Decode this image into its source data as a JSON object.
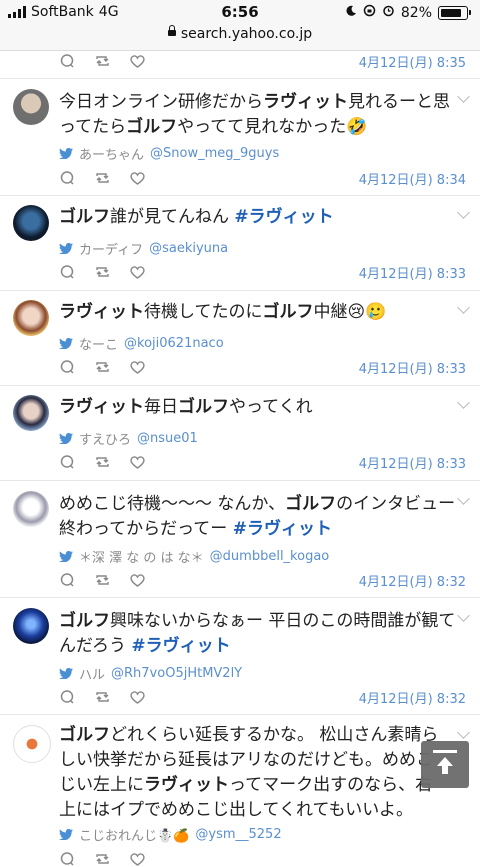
{
  "status_bar": {
    "carrier": "SoftBank",
    "network": "4G",
    "time": "6:56",
    "battery": "82%"
  },
  "browser": {
    "url": "search.yahoo.co.jp"
  },
  "colors": {
    "link_blue": "#5a8fd0",
    "hashtag_blue": "#1f5fb8",
    "divider": "#e6e6e6"
  },
  "top_row": {
    "date": "4月12日(月) 8:35"
  },
  "tweets": [
    {
      "segments": [
        {
          "t": "今日オンライン研修だから",
          "b": false
        },
        {
          "t": "ラヴィット",
          "b": true
        },
        {
          "t": "見れるーと思ってたら",
          "b": false
        },
        {
          "t": "ゴルフ",
          "b": true
        },
        {
          "t": "やってて見れなかった🤣",
          "b": false
        }
      ],
      "name": "あーちゃん",
      "handle": "@Snow_meg_9guys",
      "date": "4月12日(月) 8:34"
    },
    {
      "segments": [
        {
          "t": "ゴルフ",
          "b": true
        },
        {
          "t": "誰が見てんねん ",
          "b": false
        },
        {
          "t": "#ラヴィット",
          "tag": true
        }
      ],
      "name": "カーディフ",
      "handle": "@saekiyuna",
      "date": "4月12日(月) 8:33"
    },
    {
      "segments": [
        {
          "t": "ラヴィット",
          "b": true
        },
        {
          "t": "待機してたのに",
          "b": false
        },
        {
          "t": "ゴルフ",
          "b": true
        },
        {
          "t": "中継😢🥲",
          "b": false
        }
      ],
      "name": "なーこ",
      "handle": "@koji0621naco",
      "date": "4月12日(月) 8:33"
    },
    {
      "segments": [
        {
          "t": "ラヴィット",
          "b": true
        },
        {
          "t": "毎日",
          "b": false
        },
        {
          "t": "ゴルフ",
          "b": true
        },
        {
          "t": "やってくれ",
          "b": false
        }
      ],
      "name": "すえひろ",
      "handle": "@nsue01",
      "date": "4月12日(月) 8:33"
    },
    {
      "segments": [
        {
          "t": "めめこじ待機〜〜〜 なんか、",
          "b": false
        },
        {
          "t": "ゴルフ",
          "b": true
        },
        {
          "t": "のインタビュー終わってからだってー ",
          "b": false
        },
        {
          "t": "#ラヴィット",
          "tag": true
        }
      ],
      "name": "＊深 澤 な の は な＊",
      "handle": "@dumbbell_kogao",
      "date": "4月12日(月) 8:32"
    },
    {
      "segments": [
        {
          "t": "ゴルフ",
          "b": true
        },
        {
          "t": "興味ないからなぁー 平日のこの時間誰が観てんだろう ",
          "b": false
        },
        {
          "t": "#ラヴィット",
          "tag": true
        }
      ],
      "name": "ハル",
      "handle": "@Rh7voO5jHtMV2lY",
      "date": "4月12日(月) 8:32"
    },
    {
      "segments": [
        {
          "t": "ゴルフ",
          "b": true
        },
        {
          "t": "どれくらい延長するかな。 松山さん素晴らしい快挙だから延長はアリなのだけども。めめこじい左上に",
          "b": false
        },
        {
          "t": "ラヴィット",
          "b": true
        },
        {
          "t": "ってマーク出すのなら、右上にはイプでめめこじ出してくれてもいいよ。",
          "b": false
        }
      ],
      "name": "こじおれんじ☃️🍊",
      "handle": "@ysm__5252",
      "date": ""
    }
  ]
}
